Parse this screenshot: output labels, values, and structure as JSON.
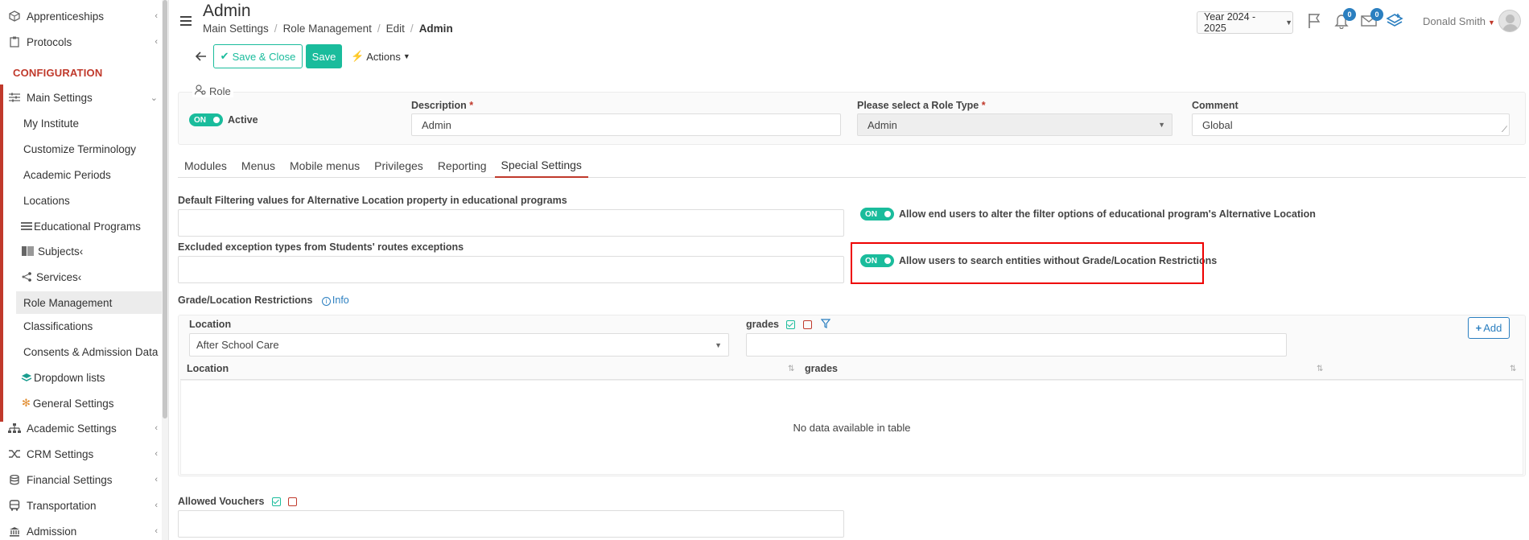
{
  "sidebar": {
    "items_top": [
      {
        "label": "Apprenticeships",
        "icon": "box-icon",
        "chevron": true
      },
      {
        "label": "Protocols",
        "icon": "clipboard-icon",
        "chevron": true
      }
    ],
    "section_title": "CONFIGURATION",
    "main_settings": {
      "label": "Main Settings",
      "icon": "sliders-icon",
      "chevron": "⌄"
    },
    "sub_items": [
      {
        "label": "My Institute"
      },
      {
        "label": "Customize Terminology"
      },
      {
        "label": "Academic Periods"
      },
      {
        "label": "Locations"
      },
      {
        "label": "Educational Programs",
        "icon": "list-icon"
      },
      {
        "label": "Subjects",
        "icon": "book-icon",
        "chevron": true
      },
      {
        "label": "Services",
        "icon": "share-icon",
        "chevron": true
      },
      {
        "label": "Role Management",
        "active": true
      },
      {
        "label": "Classifications"
      },
      {
        "label": "Consents & Admission Data"
      },
      {
        "label": "Dropdown lists",
        "icon": "layers-icon"
      },
      {
        "label": "General Settings",
        "icon": "gear-icon"
      }
    ],
    "items_bottom": [
      {
        "label": "Academic Settings",
        "icon": "org-chart-icon",
        "chevron": true
      },
      {
        "label": "CRM Settings",
        "icon": "shuffle-icon",
        "chevron": true
      },
      {
        "label": "Financial Settings",
        "icon": "coins-icon",
        "chevron": true
      },
      {
        "label": "Transportation",
        "icon": "bus-icon",
        "chevron": true
      },
      {
        "label": "Admission",
        "icon": "bank-icon",
        "chevron": true
      }
    ]
  },
  "header": {
    "title": "Admin",
    "breadcrumb": [
      "Main Settings",
      "Role Management",
      "Edit",
      "Admin"
    ],
    "year": "Year 2024 - 2025",
    "notifications_count": "0",
    "messages_count": "0",
    "user_name": "Donald Smith"
  },
  "toolbar": {
    "save_close": "Save & Close",
    "save": "Save",
    "actions": "Actions"
  },
  "role": {
    "legend": "Role",
    "active_toggle": "ON",
    "active_label": "Active",
    "description_label": "Description",
    "description_value": "Admin",
    "role_type_label": "Please select a Role Type",
    "role_type_value": "Admin",
    "comment_label": "Comment",
    "comment_value": "Global",
    "required_mark": "*"
  },
  "tabs": [
    "Modules",
    "Menus",
    "Mobile menus",
    "Privileges",
    "Reporting",
    "Special Settings"
  ],
  "special": {
    "default_filter_label": "Default Filtering values for Alternative Location property in educational programs",
    "excluded_label": "Excluded exception types from Students' routes exceptions",
    "toggle1_state": "ON",
    "toggle1_label": "Allow end users to alter the filter options of educational program's Alternative Location",
    "toggle2_state": "ON",
    "toggle2_label": "Allow users to search entities without Grade/Location Restrictions",
    "grade_restrictions_label": "Grade/Location Restrictions",
    "info_label": "Info",
    "location_label": "Location",
    "location_value": "After School Care",
    "grades_label": "grades",
    "add_label": "Add",
    "table_headers": [
      "Location",
      "grades"
    ],
    "table_empty": "No data available in table",
    "vouchers_label": "Allowed Vouchers"
  },
  "colors": {
    "accent": "#1abc9c",
    "brand_red": "#c0392b",
    "link": "#2b7fc0",
    "highlight": "#ee0000"
  }
}
